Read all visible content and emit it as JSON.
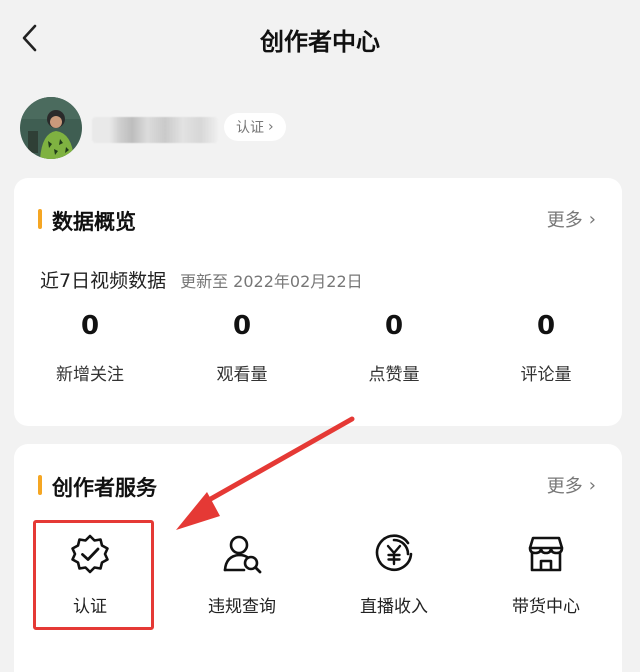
{
  "header": {
    "title": "创作者中心",
    "back_icon": "chevron-left-icon"
  },
  "profile": {
    "avatar_icon": "avatar",
    "verify_label": "认证",
    "verify_chevron": "›"
  },
  "data_overview": {
    "title": "数据概览",
    "more_label": "更多",
    "more_chevron": "›",
    "period_label": "近7日视频数据",
    "updated_label": "更新至 2022年02月22日",
    "stats": [
      {
        "value": "0",
        "label": "新增关注"
      },
      {
        "value": "0",
        "label": "观看量"
      },
      {
        "value": "0",
        "label": "点赞量"
      },
      {
        "value": "0",
        "label": "评论量"
      }
    ]
  },
  "creator_services": {
    "title": "创作者服务",
    "more_label": "更多",
    "more_chevron": "›",
    "items": [
      {
        "label": "认证",
        "icon": "verified-badge-icon"
      },
      {
        "label": "违规查询",
        "icon": "user-search-icon"
      },
      {
        "label": "直播收入",
        "icon": "yuan-circle-icon"
      },
      {
        "label": "带货中心",
        "icon": "storefront-icon"
      }
    ]
  },
  "colors": {
    "accent": "#f5a623",
    "highlight": "#e53935",
    "background": "#f2f2f2"
  }
}
